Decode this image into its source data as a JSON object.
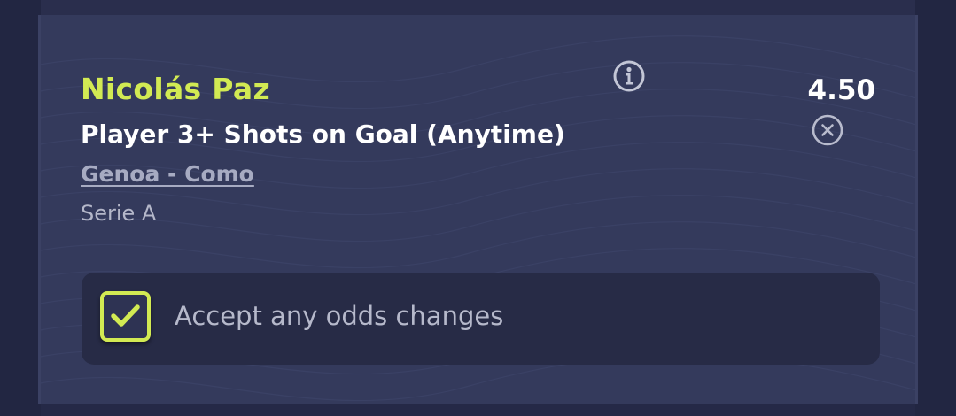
{
  "selection": {
    "player_name": "Nicolás Paz",
    "market": "Player 3+ Shots on Goal (Anytime)",
    "match": "Genoa - Como",
    "league": "Serie A",
    "odds": "4.50"
  },
  "icons": {
    "info": "info-circle-icon",
    "remove": "close-circle-icon",
    "check": "checkmark-icon"
  },
  "accept_changes": {
    "label": "Accept any odds changes",
    "checked": true
  },
  "colors": {
    "accent": "#d2ea53",
    "card_background": "#343a5c",
    "page_background": "#222642"
  }
}
